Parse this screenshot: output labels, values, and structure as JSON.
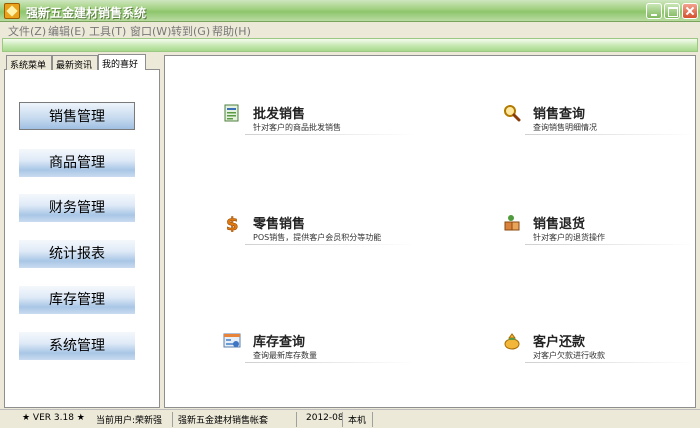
{
  "window": {
    "title": "强新五金建材销售系统"
  },
  "menu": [
    {
      "label": "文件(Z)"
    },
    {
      "label": "编辑(E)"
    },
    {
      "label": "工具(T)"
    },
    {
      "label": "窗口(W)"
    },
    {
      "label": "转到(G)"
    },
    {
      "label": "帮助(H)"
    }
  ],
  "left_tabs": [
    {
      "label": "系统菜单"
    },
    {
      "label": "最新资讯"
    },
    {
      "label": "我的喜好"
    }
  ],
  "nav": [
    {
      "label": "销售管理"
    },
    {
      "label": "商品管理"
    },
    {
      "label": "财务管理"
    },
    {
      "label": "统计报表"
    },
    {
      "label": "库存管理"
    },
    {
      "label": "系统管理"
    }
  ],
  "functions": [
    {
      "title": "批发销售",
      "desc": "针对客户的商品批发销售",
      "icon": "wholesale-icon"
    },
    {
      "title": "销售查询",
      "desc": "查询销售明细情况",
      "icon": "magnifier-icon"
    },
    {
      "title": "零售销售",
      "desc": "POS销售，提供客户会员积分等功能",
      "icon": "dollar-icon"
    },
    {
      "title": "销售退货",
      "desc": "针对客户的退货操作",
      "icon": "return-goods-icon"
    },
    {
      "title": "库存查询",
      "desc": "查询最新库存数量",
      "icon": "inventory-icon"
    },
    {
      "title": "客户还款",
      "desc": "对客户欠款进行收款",
      "icon": "money-bag-icon"
    }
  ],
  "status": {
    "version": "★ VER 3.18 ★",
    "user": "当前用户:荣新强",
    "account": "强新五金建材销售帐套",
    "period": "2012-08",
    "machine": "本机"
  },
  "colors": {
    "titlebar": "#9fcf7e",
    "toolbar_band": "#c6e8b2",
    "nav_button": "#a9c6e6",
    "chrome": "#ece9d8"
  }
}
